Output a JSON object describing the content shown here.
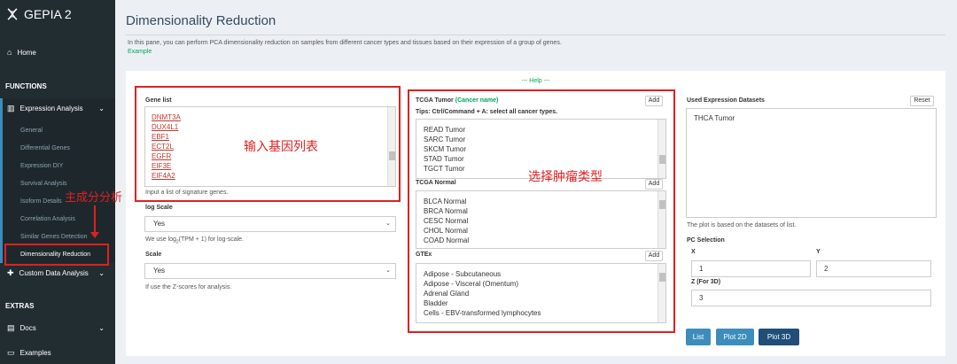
{
  "sidebar": {
    "app_title": "GEPIA 2",
    "home": "Home",
    "functions_header": "FUNCTIONS",
    "expression_analysis": "Expression Analysis",
    "sub_items": [
      "General",
      "Differential Genes",
      "Expression DIY",
      "Survival Analysis",
      "Isoform Details",
      "Correlation Analysis",
      "Similar Genes Detection",
      "Dimensionality Reduction"
    ],
    "custom_data": "Custom Data Analysis",
    "extras_header": "EXTRAS",
    "docs": "Docs",
    "examples": "Examples"
  },
  "page": {
    "title": "Dimensionality Reduction",
    "intro": "In this pane, you can perform PCA dimensionality reduction on samples from different cancer types and tissues based on their expression of a group of genes.",
    "example_link": "Example",
    "help": "--- Help ---"
  },
  "gene_list": {
    "label": "Gene list",
    "genes": [
      "DNMT3A",
      "DUX4L1",
      "EBF1",
      "ECT2L",
      "EGFR",
      "EIF3E",
      "EIF4A2"
    ],
    "hint": "Input a list of signature genes."
  },
  "log_scale": {
    "label": "log Scale",
    "value": "Yes",
    "hint_pre": "We use log",
    "hint_sub": "2",
    "hint_post": "(TPM + 1) for log-scale."
  },
  "scale": {
    "label": "Scale",
    "value": "Yes",
    "hint": "If use the Z-scores for analysis."
  },
  "tcga_tumor": {
    "label": "TCGA Tumor",
    "label_note": "(Cancer name)",
    "tips": "Tips: Ctrl/Command + A: select all cancer types.",
    "add": "Add",
    "items": [
      "READ Tumor",
      "SARC Tumor",
      "SKCM Tumor",
      "STAD Tumor",
      "TGCT Tumor"
    ]
  },
  "tcga_normal": {
    "label": "TCGA Normal",
    "add": "Add",
    "items": [
      "BLCA Normal",
      "BRCA Normal",
      "CESC Normal",
      "CHOL Normal",
      "COAD Normal"
    ]
  },
  "gtex": {
    "label": "GTEx",
    "add": "Add",
    "items": [
      "Adipose - Subcutaneous",
      "Adipose - Visceral (Omentum)",
      "Adrenal Gland",
      "Bladder",
      "Cells - EBV-transformed lymphocytes"
    ]
  },
  "datasets": {
    "label": "Used Expression Datasets",
    "reset": "Reset",
    "value": "THCA Tumor",
    "hint": "The plot is based on the datasets of list."
  },
  "pc_selection": {
    "label": "PC Selection",
    "x_label": "X",
    "x_value": "1",
    "y_label": "Y",
    "y_value": "2",
    "z_label": "Z (For 3D)",
    "z_value": "3"
  },
  "buttons": {
    "list": "List",
    "plot2d": "Plot 2D",
    "plot3d": "Plot 3D"
  },
  "annotations": {
    "input_genes": "输入基因列表",
    "select_tumor": "选择肿瘤类型",
    "pca": "主成分分析"
  },
  "colors": {
    "sidebar": "#222d32",
    "accent": "#00a65a",
    "primary_button": "#3c8dbc",
    "annotation": "#e02020"
  }
}
